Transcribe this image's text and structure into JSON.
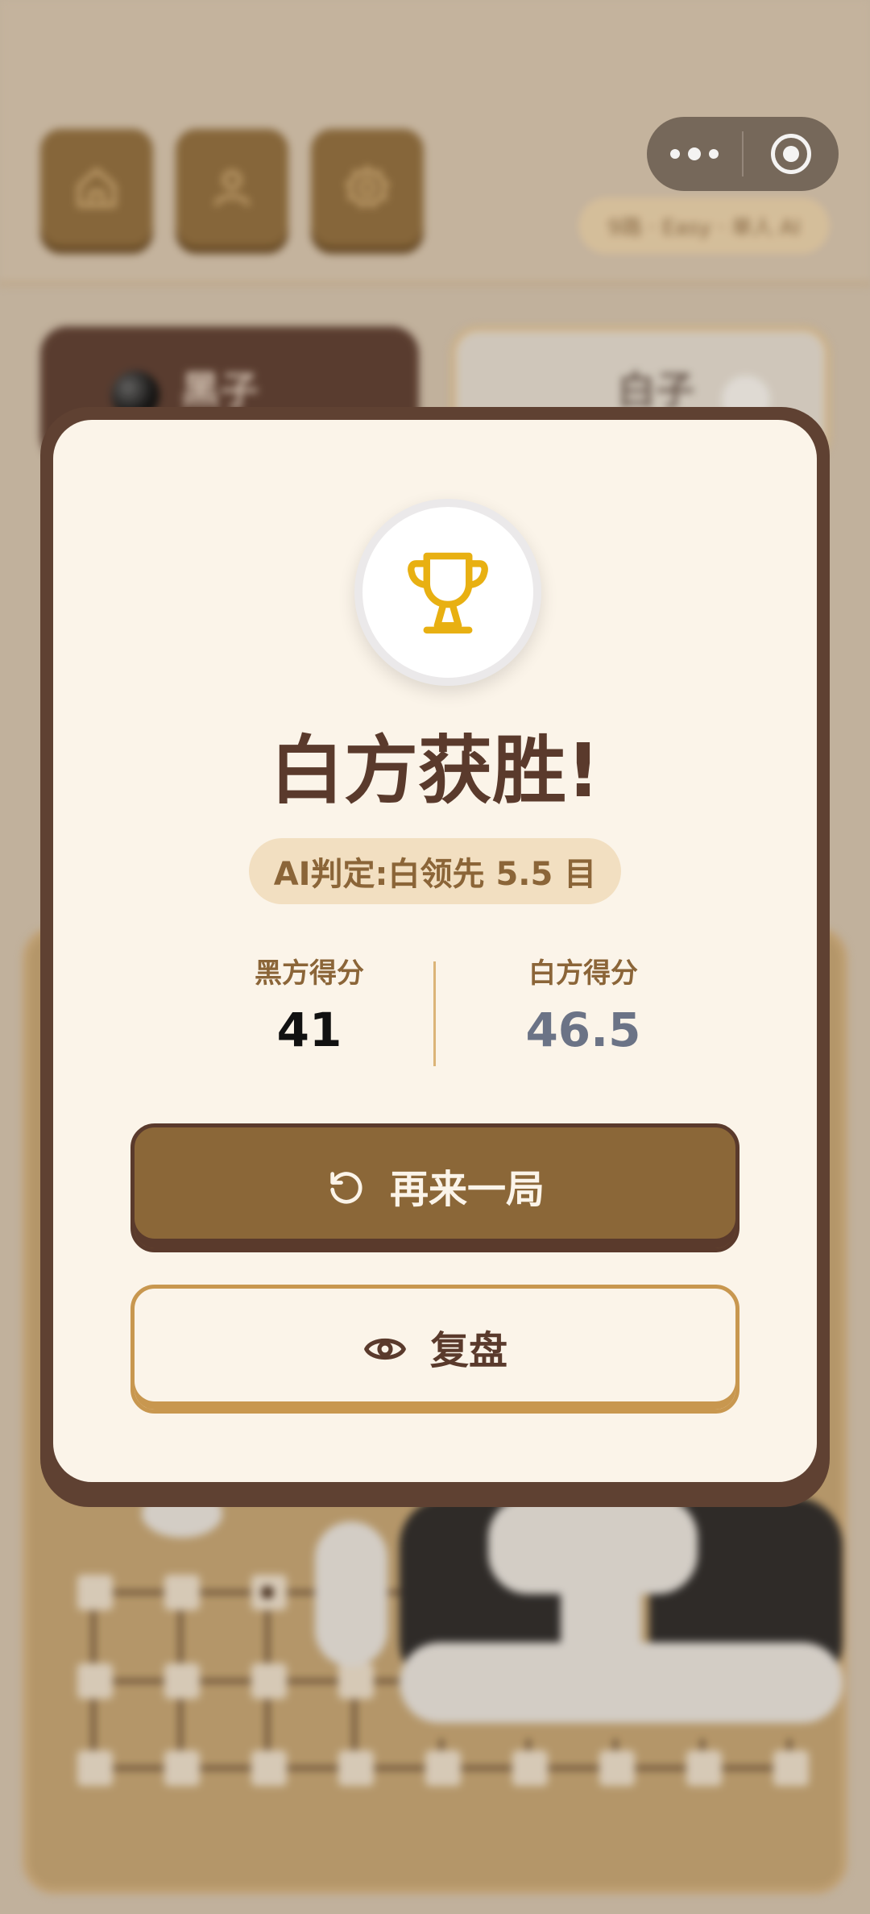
{
  "header": {
    "level_text": "9路 · Easy · 单人 AI",
    "buttons": [
      {
        "icon": "home-icon"
      },
      {
        "icon": "user-icon"
      },
      {
        "icon": "gear-icon"
      }
    ]
  },
  "players": {
    "black": {
      "name": "黑子"
    },
    "white": {
      "name": "白子"
    }
  },
  "result": {
    "icon": "trophy-icon",
    "title": "白方获胜!",
    "verdict": "AI判定:白领先 5.5 目",
    "black_label": "黑方得分",
    "black_score": "41",
    "white_label": "白方得分",
    "white_score": "46.5"
  },
  "actions": {
    "play_again": "再来一局",
    "play_again_icon": "restart-icon",
    "replay": "复盘",
    "replay_icon": "eye-icon"
  },
  "colors": {
    "brown_dark": "#5a3a2c",
    "brown_button": "#8b6738",
    "cream": "#fbf4e9",
    "gold": "#e8b012",
    "white_score": "#6b7386"
  }
}
